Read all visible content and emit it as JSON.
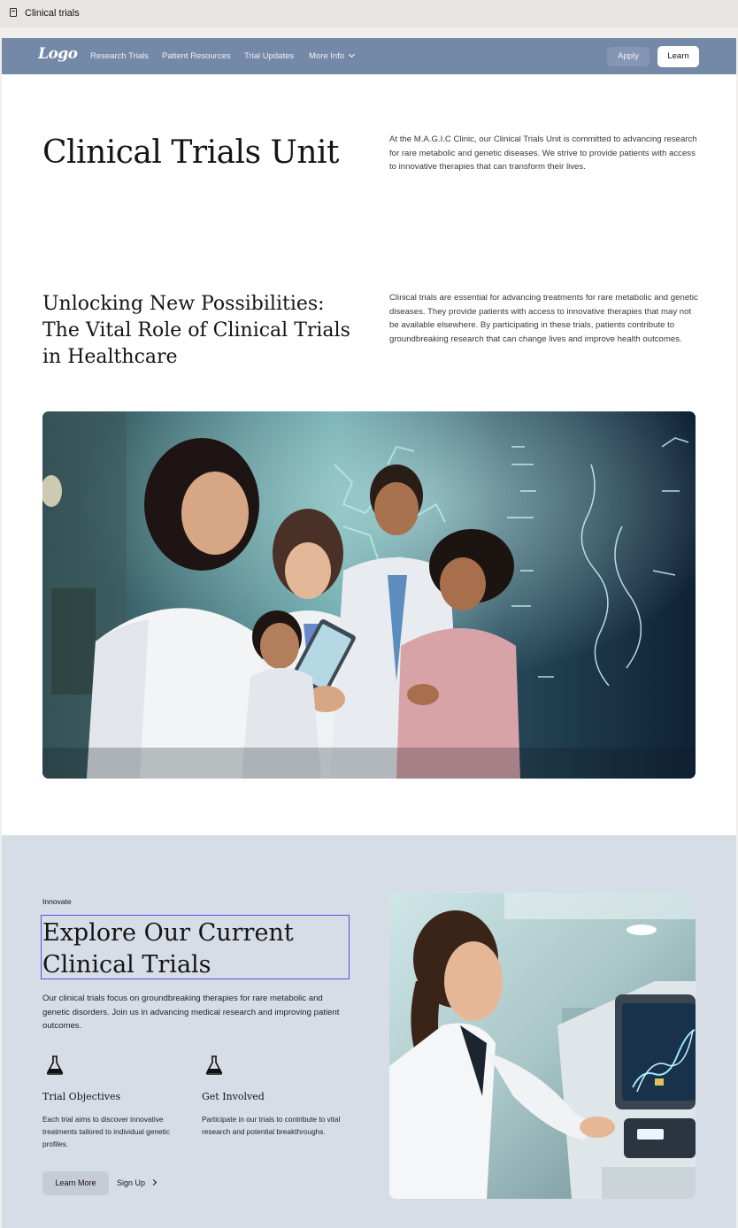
{
  "tab": {
    "title": "Clinical trials",
    "icon": "document-icon"
  },
  "nav": {
    "logo": "Logo",
    "links": [
      "Research Trials",
      "Patient Resources",
      "Trial Updates",
      "More Info"
    ],
    "apply": "Apply",
    "learn": "Learn",
    "bg_color": "#7488a8"
  },
  "header": {
    "title": "Clinical Trials Unit",
    "intro": "At the M.A.G.I.C Clinic, our Clinical Trials Unit is committed to advancing research for rare metabolic and genetic diseases. We strive to provide patients with access to innovative therapies that can transform their lives."
  },
  "section1": {
    "heading": "Unlocking New Possibilities: The Vital Role of Clinical Trials in Healthcare",
    "text": "Clinical trials are essential for advancing treatments for rare metabolic and genetic diseases. They provide patients with access to innovative therapies that may not be available elsewhere. By participating in these trials, patients contribute to groundbreaking research that can change lives and improve health outcomes."
  },
  "section2": {
    "eyebrow": "Innovate",
    "heading": "Explore Our Current Clinical Trials",
    "text": "Our clinical trials focus on groundbreaking therapies for rare metabolic and genetic disorders. Join us in advancing medical research and improving patient outcomes.",
    "features": [
      {
        "icon": "flask-icon",
        "title": "Trial Objectives",
        "text": "Each trial aims to discover innovative treatments tailored to individual genetic profiles."
      },
      {
        "icon": "flask-icon",
        "title": "Get Involved",
        "text": "Participate in our trials to contribute to vital research and potential breakthroughs."
      }
    ],
    "learn_more": "Learn More",
    "sign_up": "Sign Up",
    "bg_color": "#d7dde7"
  }
}
